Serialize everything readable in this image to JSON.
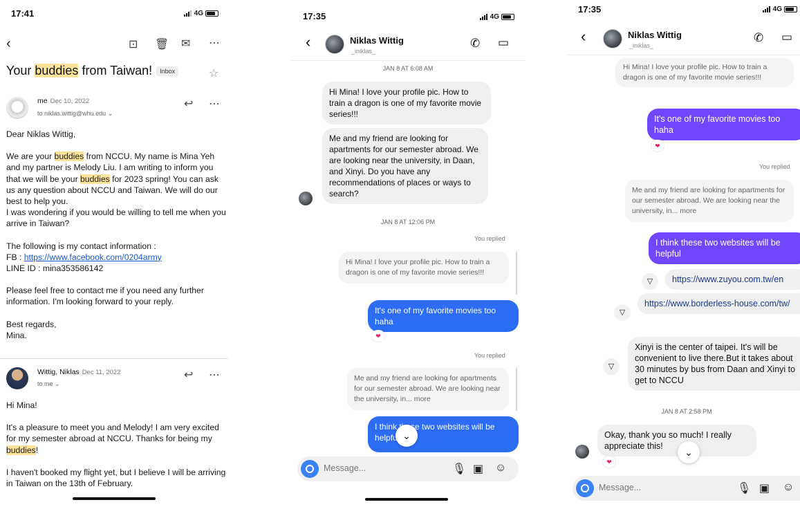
{
  "email": {
    "status_time": "17:41",
    "network": "4G",
    "subject_part1": "Your ",
    "subject_highlight": "buddies",
    "subject_part2": " from Taiwan!",
    "inbox_label": "Inbox",
    "msg1": {
      "sender": "me",
      "date": "Dec 10, 2022",
      "to": "to niklas.wittig@whu.edu ⌄",
      "greeting": "Dear Niklas Wittig,",
      "p1_a": "We are your ",
      "p1_hl1": "buddies",
      "p1_b": " from NCCU. My name is Mina Yeh and my partner is Melody Liu. I am writing to inform you that we will be your ",
      "p1_hl2": "buddies",
      "p1_c": " for 2023 spring! You can ask us any question about NCCU and Taiwan. We will do our best to help you.",
      "p1_d": "I was wondering if you would be willing to tell me when you arrive in Taiwan?",
      "contact_intro": "The following is my contact information :",
      "fb_label": "FB : ",
      "fb_link": "https://www.facebook.com/0204army",
      "line": "LINE ID : mina353586142",
      "p3": "Please feel free to contact me if you need any further information. I'm looking forward to your reply.",
      "closing": "Best regards,",
      "signature": "Mina."
    },
    "msg2": {
      "sender": "Wittig, Niklas",
      "date": "Dec 11, 2022",
      "to": "to me ⌄",
      "greeting": "Hi Mina!",
      "p1_a": "It's a pleasure to meet you and Melody! I am very excited for my semester abroad at NCCU. Thanks for being my ",
      "p1_hl": "buddies",
      "p1_b": "!",
      "p2": "I haven't booked my flight yet, but I believe I will be arriving in Taiwan on the 13th of February."
    }
  },
  "chat1": {
    "status_time": "17:35",
    "network": "4G",
    "name": "Niklas Wittig",
    "handle": "_iniklas_",
    "stamp1": "JAN 8 AT 6:08 AM",
    "in1": "Hi Mina! I love your profile pic. How to train a dragon is one of my favorite movie series!!!",
    "in2": "Me and my friend are looking for apartments for our semester abroad. We are looking near the university, in Daan, and Xinyi. Do you have any recommendations of places or ways to search?",
    "stamp2": "JAN 8 AT 12:06 PM",
    "you_replied": "You replied",
    "quote1": "Hi Mina! I love your profile pic. How to train a dragon is one of my favorite movie series!!!",
    "out1": "It's one of my favorite movies too haha",
    "heart": "❤",
    "quote2": "Me and my friend are looking for apartments for our semester abroad. We are looking near the university, in... more",
    "out2": "I think these two websites will be helpful",
    "placeholder": "Message..."
  },
  "chat2": {
    "status_time": "17:35",
    "network": "4G",
    "name": "Niklas Wittig",
    "handle": "_iniklas_",
    "quote1": "Hi Mina! I love your profile pic. How to train a dragon is one of my favorite movie series!!!",
    "out1": "It's one of my favorite movies too haha",
    "heart": "❤",
    "you_replied": "You replied",
    "quote2": "Me and my friend are looking for apartments for our semester abroad. We are looking near the university, in... more",
    "out2": "I think these two websites will be helpful",
    "link1": "https://www.zuyou.com.tw/en",
    "link2": "https://www.borderless-house.com/tw/",
    "out3": "Xinyi is the center of taipei. It's will be convenient to live  there.But it takes about 30 minutes by bus from Daan and Xinyi to get to NCCU",
    "stamp3": "JAN 8 AT 2:58 PM",
    "in3": "Okay, thank you so much! I really appreciate this!",
    "placeholder": "Message..."
  }
}
